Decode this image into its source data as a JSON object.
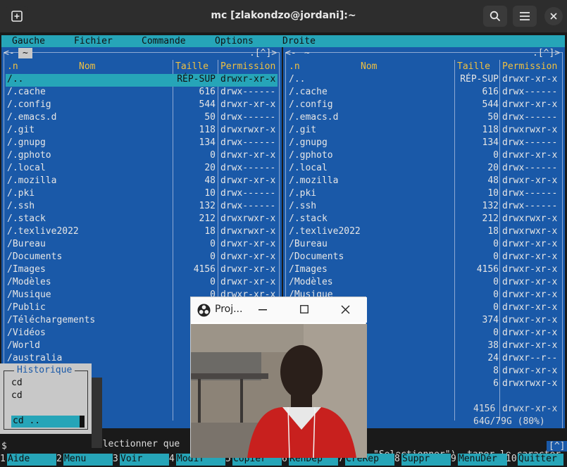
{
  "window": {
    "title": "mc [zlakondzo@jordani]:~"
  },
  "menubar": [
    "Gauche",
    "Fichier",
    "Commande",
    "Options",
    "Droite"
  ],
  "left_panel": {
    "path": "~",
    "corner": ".[^]>",
    "columns": {
      "name": "Nom",
      "size": "Taille",
      "perm": "Permission",
      "sort": ".n"
    },
    "rows": [
      {
        "name": "/..",
        "size": "RÉP-SUP",
        "perm": "drwxr-xr-x",
        "selected": true
      },
      {
        "name": "/.cache",
        "size": "616",
        "perm": "drwx------"
      },
      {
        "name": "/.config",
        "size": "544",
        "perm": "drwxr-xr-x"
      },
      {
        "name": "/.emacs.d",
        "size": "50",
        "perm": "drwx------"
      },
      {
        "name": "/.git",
        "size": "118",
        "perm": "drwxrwxr-x"
      },
      {
        "name": "/.gnupg",
        "size": "134",
        "perm": "drwx------"
      },
      {
        "name": "/.gphoto",
        "size": "0",
        "perm": "drwxr-xr-x"
      },
      {
        "name": "/.local",
        "size": "20",
        "perm": "drwx------"
      },
      {
        "name": "/.mozilla",
        "size": "48",
        "perm": "drwxr-xr-x"
      },
      {
        "name": "/.pki",
        "size": "10",
        "perm": "drwx------"
      },
      {
        "name": "/.ssh",
        "size": "132",
        "perm": "drwx------"
      },
      {
        "name": "/.stack",
        "size": "212",
        "perm": "drwxrwxr-x"
      },
      {
        "name": "/.texlive2022",
        "size": "18",
        "perm": "drwxrwxr-x"
      },
      {
        "name": "/Bureau",
        "size": "0",
        "perm": "drwxr-xr-x"
      },
      {
        "name": "/Documents",
        "size": "0",
        "perm": "drwxr-xr-x"
      },
      {
        "name": "/Images",
        "size": "4156",
        "perm": "drwxr-xr-x"
      },
      {
        "name": "/Modèles",
        "size": "0",
        "perm": "drwxr-xr-x"
      },
      {
        "name": "/Musique",
        "size": "0",
        "perm": "drwxr-xr-x"
      },
      {
        "name": "/Public",
        "size": "",
        "perm": ""
      },
      {
        "name": "/Téléchargements",
        "size": "",
        "perm": ""
      },
      {
        "name": "/Vidéos",
        "size": "",
        "perm": ""
      },
      {
        "name": "/World",
        "size": "",
        "perm": ""
      },
      {
        "name": "/australia",
        "size": "",
        "perm": ""
      }
    ]
  },
  "right_panel": {
    "path": "~",
    "corner": ".[^]>",
    "columns": {
      "name": "Nom",
      "size": "Taille",
      "perm": "Permission",
      "sort": ".n"
    },
    "rows": [
      {
        "name": "/..",
        "size": "RÉP-SUP",
        "perm": "drwxr-xr-x"
      },
      {
        "name": "/.cache",
        "size": "616",
        "perm": "drwx------"
      },
      {
        "name": "/.config",
        "size": "544",
        "perm": "drwxr-xr-x"
      },
      {
        "name": "/.emacs.d",
        "size": "50",
        "perm": "drwx------"
      },
      {
        "name": "/.git",
        "size": "118",
        "perm": "drwxrwxr-x"
      },
      {
        "name": "/.gnupg",
        "size": "134",
        "perm": "drwx------"
      },
      {
        "name": "/.gphoto",
        "size": "0",
        "perm": "drwxr-xr-x"
      },
      {
        "name": "/.local",
        "size": "20",
        "perm": "drwx------"
      },
      {
        "name": "/.mozilla",
        "size": "48",
        "perm": "drwxr-xr-x"
      },
      {
        "name": "/.pki",
        "size": "10",
        "perm": "drwx------"
      },
      {
        "name": "/.ssh",
        "size": "132",
        "perm": "drwx------"
      },
      {
        "name": "/.stack",
        "size": "212",
        "perm": "drwxrwxr-x"
      },
      {
        "name": "/.texlive2022",
        "size": "18",
        "perm": "drwxrwxr-x"
      },
      {
        "name": "/Bureau",
        "size": "0",
        "perm": "drwxr-xr-x"
      },
      {
        "name": "/Documents",
        "size": "0",
        "perm": "drwxr-xr-x"
      },
      {
        "name": "/Images",
        "size": "4156",
        "perm": "drwxr-xr-x"
      },
      {
        "name": "/Modèles",
        "size": "0",
        "perm": "drwxr-xr-x"
      },
      {
        "name": "/Musique",
        "size": "0",
        "perm": "drwxr-xr-x"
      },
      {
        "name": "",
        "size": "0",
        "perm": "drwxr-xr-x"
      },
      {
        "name": "ts",
        "size": "374",
        "perm": "drwxr-xr-x"
      },
      {
        "name": "",
        "size": "0",
        "perm": "drwxr-xr-x"
      },
      {
        "name": "",
        "size": "38",
        "perm": "drwxr-xr-x"
      },
      {
        "name": "",
        "size": "24",
        "perm": "drwxr--r--"
      },
      {
        "name": "",
        "size": "8",
        "perm": "drwxr-xr-x"
      },
      {
        "name": "",
        "size": "6",
        "perm": "drwxrwxr-x"
      }
    ],
    "status_size": "4156",
    "status_perm": "drwxr-xr-x",
    "disk": "64G/79G (80%)"
  },
  "history": {
    "title": "Historique",
    "items": [
      "cd",
      "cd"
    ],
    "selected": "cd .."
  },
  "hint_left": "sélectionner que",
  "hint_right": "\"Selectionner\"), taper le caractèr",
  "prompt": "$",
  "prompt_tail": "[^]",
  "fkeys": [
    {
      "n": "1",
      "label": "Aide"
    },
    {
      "n": "2",
      "label": "Menu"
    },
    {
      "n": "3",
      "label": "Voir"
    },
    {
      "n": "4",
      "label": "Modif"
    },
    {
      "n": "5",
      "label": "Copier"
    },
    {
      "n": "6",
      "label": "RenDep"
    },
    {
      "n": "7",
      "label": "CréRep"
    },
    {
      "n": "8",
      "label": "Suppr"
    },
    {
      "n": "9",
      "label": "MenuDér"
    },
    {
      "n": "10",
      "label": "Quitter"
    }
  ],
  "projector": {
    "title": "Proj..."
  },
  "colors": {
    "panel": "#1a59a8",
    "accent": "#26a5b8",
    "header": "#f0c040"
  }
}
